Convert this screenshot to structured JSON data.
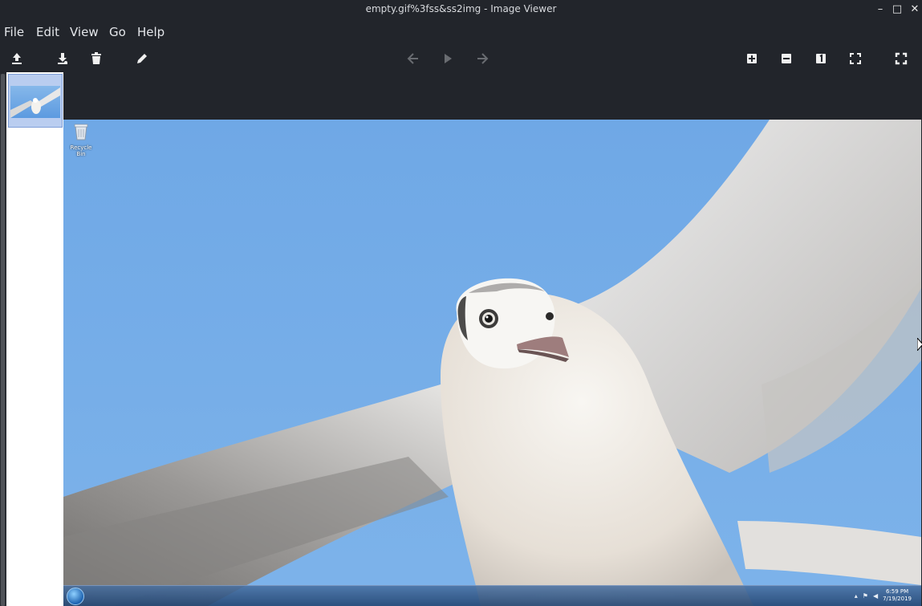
{
  "window": {
    "title": "empty.gif%3fss&ss2img - Image Viewer",
    "controls": {
      "minimize": "–",
      "maximize": "□",
      "close": "✕"
    }
  },
  "menu": [
    {
      "label": "File"
    },
    {
      "label": "Edit"
    },
    {
      "label": "View"
    },
    {
      "label": "Go"
    },
    {
      "label": "Help"
    }
  ],
  "toolbar": {
    "left": [
      "upload-icon",
      "download-icon",
      "trash-icon",
      "pencil-icon"
    ],
    "center": [
      "arrow-left-icon",
      "play-icon",
      "arrow-right-icon"
    ],
    "right": [
      "zoom-in-icon",
      "zoom-out-icon",
      "actual-size-icon",
      "fit-icon",
      "fullscreen-icon"
    ]
  },
  "thumbnails": [
    {
      "selected": true
    }
  ],
  "image": {
    "desktop_icon_label": "Recycle Bin",
    "tray": {
      "time": "6:59 PM",
      "date": "7/19/2019"
    }
  },
  "colors": {
    "bg": "#22252b",
    "sky": "#76ace6",
    "thumb_selected": "#b9cdf0"
  }
}
